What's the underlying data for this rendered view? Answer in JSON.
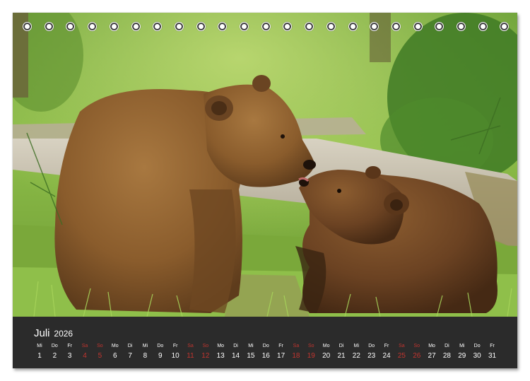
{
  "calendar": {
    "month": "Juli",
    "year": "2026",
    "days": [
      {
        "dow": "Mi",
        "num": "1",
        "weekend": false
      },
      {
        "dow": "Do",
        "num": "2",
        "weekend": false
      },
      {
        "dow": "Fr",
        "num": "3",
        "weekend": false
      },
      {
        "dow": "Sa",
        "num": "4",
        "weekend": true
      },
      {
        "dow": "So",
        "num": "5",
        "weekend": true
      },
      {
        "dow": "Mo",
        "num": "6",
        "weekend": false
      },
      {
        "dow": "Di",
        "num": "7",
        "weekend": false
      },
      {
        "dow": "Mi",
        "num": "8",
        "weekend": false
      },
      {
        "dow": "Do",
        "num": "9",
        "weekend": false
      },
      {
        "dow": "Fr",
        "num": "10",
        "weekend": false
      },
      {
        "dow": "Sa",
        "num": "11",
        "weekend": true
      },
      {
        "dow": "So",
        "num": "12",
        "weekend": true
      },
      {
        "dow": "Mo",
        "num": "13",
        "weekend": false
      },
      {
        "dow": "Di",
        "num": "14",
        "weekend": false
      },
      {
        "dow": "Mi",
        "num": "15",
        "weekend": false
      },
      {
        "dow": "Do",
        "num": "16",
        "weekend": false
      },
      {
        "dow": "Fr",
        "num": "17",
        "weekend": false
      },
      {
        "dow": "Sa",
        "num": "18",
        "weekend": true
      },
      {
        "dow": "So",
        "num": "19",
        "weekend": true
      },
      {
        "dow": "Mo",
        "num": "20",
        "weekend": false
      },
      {
        "dow": "Di",
        "num": "21",
        "weekend": false
      },
      {
        "dow": "Mi",
        "num": "22",
        "weekend": false
      },
      {
        "dow": "Do",
        "num": "23",
        "weekend": false
      },
      {
        "dow": "Fr",
        "num": "24",
        "weekend": false
      },
      {
        "dow": "Sa",
        "num": "25",
        "weekend": true
      },
      {
        "dow": "So",
        "num": "26",
        "weekend": true
      },
      {
        "dow": "Mo",
        "num": "27",
        "weekend": false
      },
      {
        "dow": "Di",
        "num": "28",
        "weekend": false
      },
      {
        "dow": "Mi",
        "num": "29",
        "weekend": false
      },
      {
        "dow": "Do",
        "num": "30",
        "weekend": false
      },
      {
        "dow": "Fr",
        "num": "31",
        "weekend": false
      }
    ]
  },
  "colors": {
    "calendar_bg": "#2b2b2b",
    "weekend": "#c2352f",
    "text": "#ffffff"
  },
  "photo": {
    "subject": "two-brown-bears"
  },
  "binding": {
    "ring_count": 23
  }
}
